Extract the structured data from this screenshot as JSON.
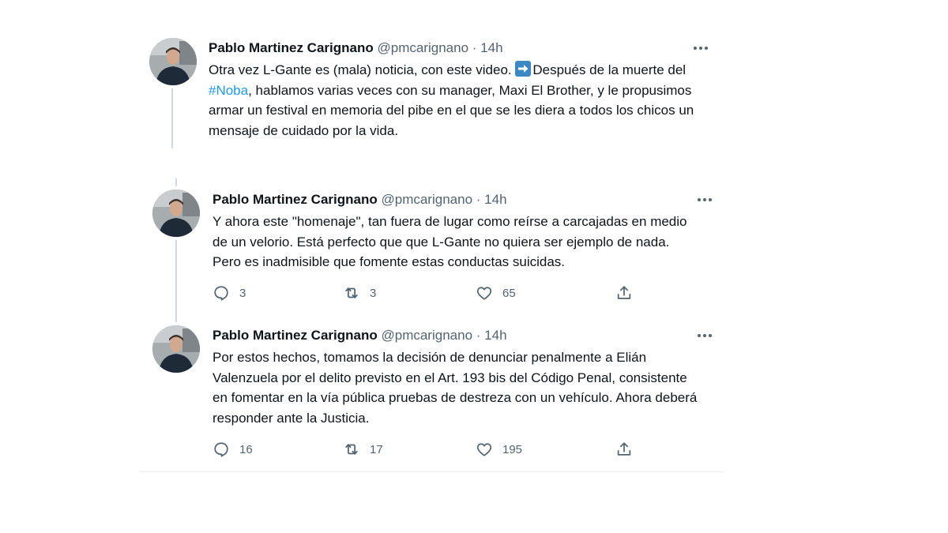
{
  "tweets": [
    {
      "author": "Pablo Martinez Carignano",
      "handle": "@pmcarignano",
      "separator": "·",
      "time": "14h",
      "text_a": "Otra vez L-Gante es (mala) noticia, con este video. ",
      "text_b": "Después de la muerte del ",
      "hashtag": "#Noba",
      "text_c": ", hablamos varias veces con su manager, Maxi El Brother, y le propusimos armar un festival en memoria del pibe en el que se les diera a todos los chicos un mensaje de cuidado por la vida."
    },
    {
      "author": "Pablo Martinez Carignano",
      "handle": "@pmcarignano",
      "separator": "·",
      "time": "14h",
      "text": "Y ahora este \"homenaje\", tan fuera de lugar como reírse a carcajadas en medio de un velorio. Está perfecto que que L-Gante no quiera ser ejemplo de nada. Pero es inadmisible que fomente estas conductas suicidas.",
      "replies": "3",
      "retweets": "3",
      "likes": "65"
    },
    {
      "author": "Pablo Martinez Carignano",
      "handle": "@pmcarignano",
      "separator": "·",
      "time": "14h",
      "text": "Por estos hechos, tomamos la decisión de denunciar penalmente a Elián Valenzuela por el delito previsto en el Art. 193 bis del Código Penal, consistente en fomentar en la vía pública pruebas de destreza con un vehículo. Ahora deberá responder ante la Justicia.",
      "replies": "16",
      "retweets": "17",
      "likes": "195"
    }
  ],
  "icons": {
    "more": "more-icon",
    "reply": "reply-icon",
    "retweet": "retweet-icon",
    "like": "like-icon",
    "share": "share-icon",
    "arrow_emoji": "right-arrow-emoji-icon"
  },
  "colors": {
    "text": "#0f1419",
    "secondary": "#536471",
    "hashtag": "#1d9bf0",
    "thread_line": "#cfd9de",
    "divider": "#eff3f4",
    "emoji_blue": "#3b88c3"
  }
}
